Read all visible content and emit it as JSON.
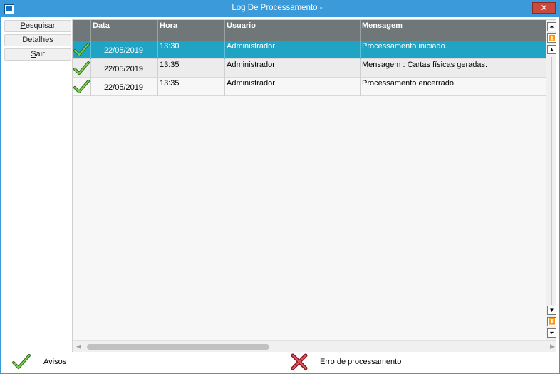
{
  "window": {
    "title": "Log De Processamento -",
    "close_glyph": "✕"
  },
  "side_buttons": [
    {
      "label": "Pesquisar",
      "accel": "P",
      "rest": "esquisar"
    },
    {
      "label": "Detalhes"
    },
    {
      "label": "Sair",
      "accel": "S",
      "rest": "air"
    }
  ],
  "grid": {
    "columns": [
      "",
      "Data",
      "Hora",
      "Usuario",
      "Mensagem"
    ],
    "rows": [
      {
        "status_icon": "check-icon",
        "date": "22/05/2019",
        "time": "13:30",
        "user": "Administrador",
        "message": "Processamento iniciado.",
        "selected": true
      },
      {
        "status_icon": "check-icon",
        "date": "22/05/2019",
        "time": "13:35",
        "user": "Administrador",
        "message": "Mensagem : Cartas físicas geradas.",
        "selected": false
      },
      {
        "status_icon": "check-icon",
        "date": "22/05/2019",
        "time": "13:35",
        "user": "Administrador",
        "message": "Processamento encerrado.",
        "selected": false
      }
    ]
  },
  "legend": {
    "warnings_label": "Avisos",
    "warnings_icon": "check-icon",
    "error_label": "Erro de processamento",
    "error_icon": "x-icon"
  },
  "colors": {
    "titlebar": "#3b9ad9",
    "header": "#6f7779",
    "selected_row": "#1fa4c6",
    "check_green": "#5aa83a",
    "error_red": "#c7303b"
  }
}
